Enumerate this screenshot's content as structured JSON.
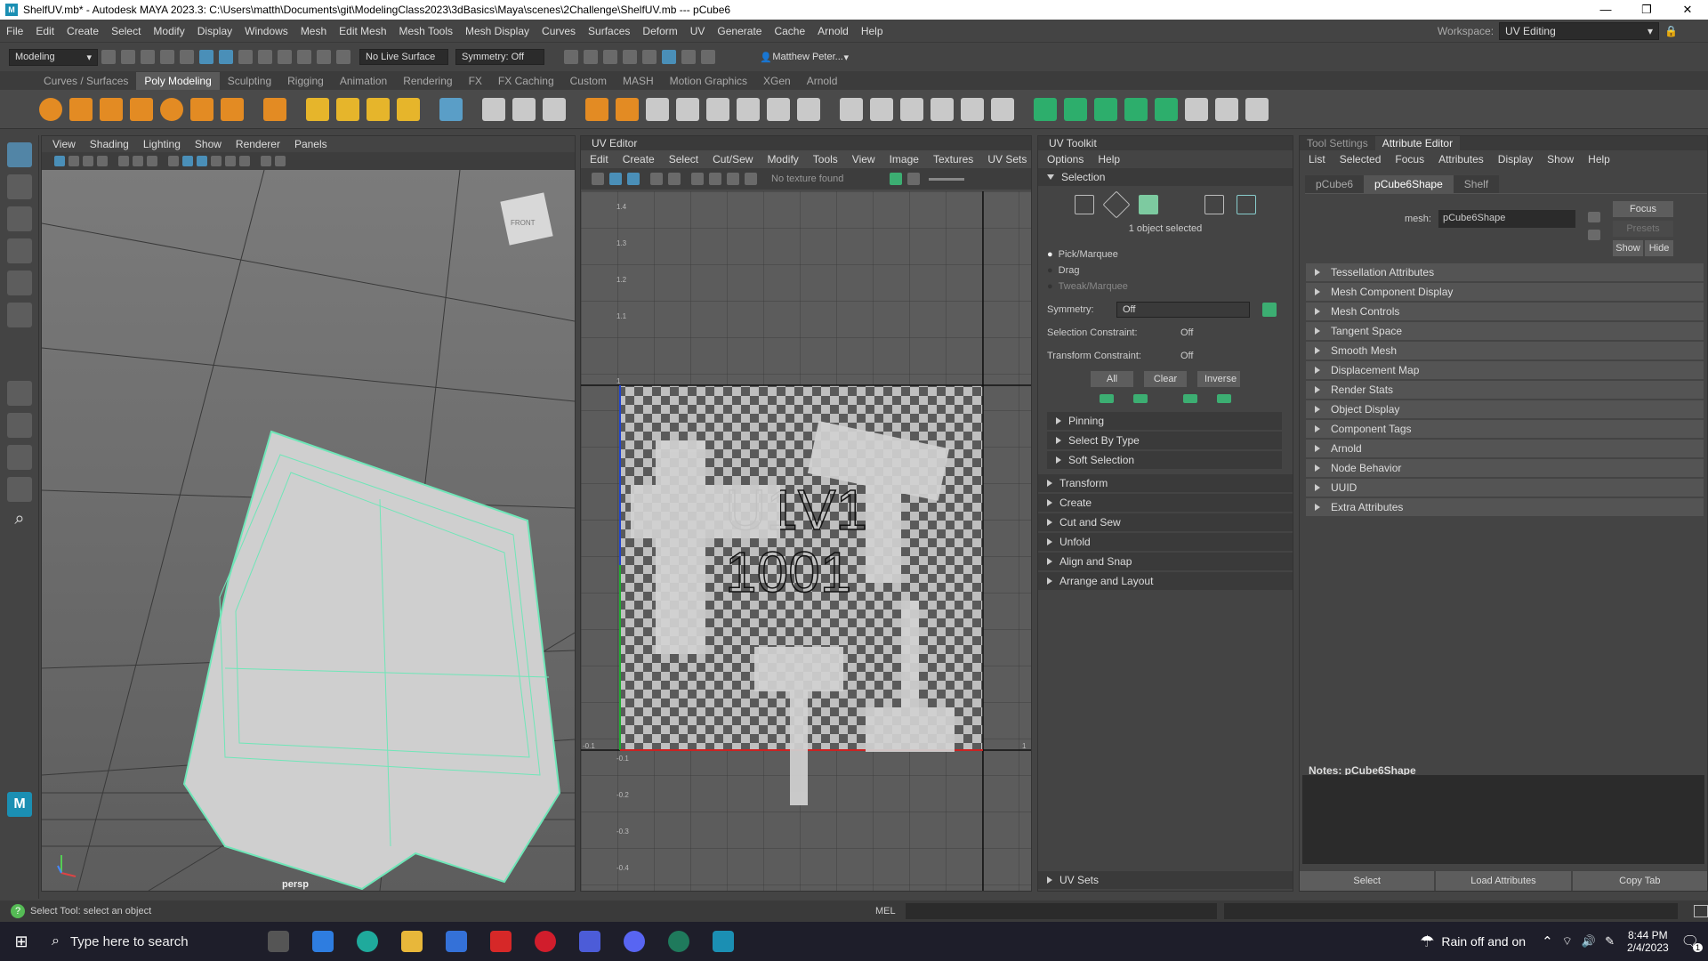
{
  "window": {
    "title": "ShelfUV.mb* - Autodesk MAYA 2023.3: C:\\Users\\matth\\Documents\\git\\ModelingClass2023\\3dBasics\\Maya\\scenes\\2Challenge\\ShelfUV.mb   ---   pCube6",
    "workspace_label": "Workspace:",
    "workspace_value": "UV Editing"
  },
  "menus": [
    "File",
    "Edit",
    "Create",
    "Select",
    "Modify",
    "Display",
    "Windows",
    "Mesh",
    "Edit Mesh",
    "Mesh Tools",
    "Mesh Display",
    "Curves",
    "Surfaces",
    "Deform",
    "UV",
    "Generate",
    "Cache",
    "Arnold",
    "Help"
  ],
  "statusline": {
    "mode": "Modeling",
    "live_surface": "No Live Surface",
    "symmetry": "Symmetry: Off",
    "user": "Matthew Peter..."
  },
  "shelf_tabs": [
    "Curves / Surfaces",
    "Poly Modeling",
    "Sculpting",
    "Rigging",
    "Animation",
    "Rendering",
    "FX",
    "FX Caching",
    "Custom",
    "MASH",
    "Motion Graphics",
    "XGen",
    "Arnold"
  ],
  "shelf_active": "Poly Modeling",
  "viewport": {
    "menus": [
      "View",
      "Shading",
      "Lighting",
      "Show",
      "Renderer",
      "Panels"
    ],
    "camera_label": "persp",
    "viewcube_label": "FRONT"
  },
  "uv_editor": {
    "title": "UV Editor",
    "menus": [
      "Edit",
      "Create",
      "Select",
      "Cut/Sew",
      "Modify",
      "Tools",
      "View",
      "Image",
      "Textures",
      "UV Sets"
    ],
    "texture_status": "No texture found",
    "udim_label_1": "U1V1",
    "udim_label_2": "1001",
    "tick_labels_left": [
      "1.4",
      "1.3",
      "1.2",
      "1.1",
      "1",
      "-0.1",
      "-0.2",
      "-0.3",
      "-0.4"
    ],
    "tick_label_right": "1",
    "tick_label_bottom_left": "-0.1"
  },
  "uv_toolkit": {
    "title": "UV Toolkit",
    "menus": [
      "Options",
      "Help"
    ],
    "selection_header": "Selection",
    "selected_count": "1 object selected",
    "modes": [
      "Pick/Marquee",
      "Drag",
      "Tweak/Marquee"
    ],
    "symmetry_label": "Symmetry:",
    "symmetry_value": "Off",
    "selection_constraint_label": "Selection Constraint:",
    "selection_constraint_value": "Off",
    "transform_constraint_label": "Transform Constraint:",
    "transform_constraint_value": "Off",
    "buttons": [
      "All",
      "Clear",
      "Inverse"
    ],
    "subsections": [
      "Pinning",
      "Select By Type",
      "Soft Selection"
    ],
    "sections": [
      "Transform",
      "Create",
      "Cut and Sew",
      "Unfold",
      "Align and Snap",
      "Arrange and Layout"
    ],
    "uvsets": "UV Sets"
  },
  "attribute_editor": {
    "tabs_top": [
      "Tool Settings",
      "Attribute Editor"
    ],
    "menus": [
      "List",
      "Selected",
      "Focus",
      "Attributes",
      "Display",
      "Show",
      "Help"
    ],
    "node_tabs": [
      "pCube6",
      "pCube6Shape",
      "Shelf"
    ],
    "mesh_label": "mesh:",
    "mesh_value": "pCube6Shape",
    "focus_btn": "Focus",
    "presets_btn": "Presets",
    "show_btn": "Show",
    "hide_btn": "Hide",
    "sections": [
      "Tessellation Attributes",
      "Mesh Component Display",
      "Mesh Controls",
      "Tangent Space",
      "Smooth Mesh",
      "Displacement Map",
      "Render Stats",
      "Object Display",
      "Component Tags",
      "Arnold",
      "Node Behavior",
      "UUID",
      "Extra Attributes"
    ],
    "notes_label": "Notes:  pCube6Shape",
    "bottom_buttons": [
      "Select",
      "Load Attributes",
      "Copy Tab"
    ]
  },
  "status_bar": {
    "help": "Select Tool: select an object",
    "mel": "MEL"
  },
  "taskbar": {
    "search_placeholder": "Type here to search",
    "weather": "Rain off and on",
    "time": "8:44 PM",
    "date": "2/4/2023",
    "notification_count": "1"
  }
}
